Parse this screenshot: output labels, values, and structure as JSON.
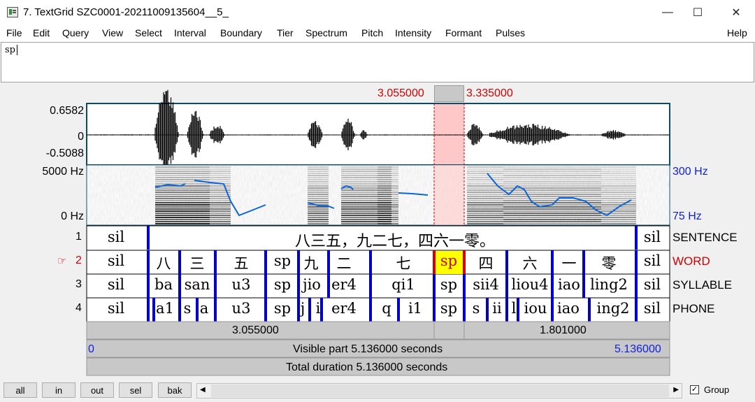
{
  "window": {
    "title": "7. TextGrid SZC0001-20211009135604__5_",
    "minimize": "—",
    "maximize": "☐",
    "close": "✕"
  },
  "menu": [
    "File",
    "Edit",
    "Query",
    "View",
    "Select",
    "Interval",
    "Boundary",
    "Tier",
    "Spectrum",
    "Pitch",
    "Intensity",
    "Formant",
    "Pulses"
  ],
  "help": "Help",
  "text_field": {
    "value": "sp"
  },
  "selection": {
    "start": "3.055000",
    "end": "3.335000"
  },
  "waveform": {
    "ymax": "0.6582",
    "zero": "0",
    "ymin": "-0.5088"
  },
  "spectrogram": {
    "fmax": "5000 Hz",
    "fmin": "0 Hz",
    "pitch_max": "300 Hz",
    "pitch_min": "75 Hz"
  },
  "tiers": [
    {
      "number": "1",
      "name": "SENTENCE",
      "intervals": [
        "sil",
        "八三五，九二七，四六一零。",
        "sil"
      ]
    },
    {
      "number": "2",
      "name": "WORD",
      "selected_mark": "☞",
      "intervals": [
        "sil",
        "八",
        "三",
        "五",
        "sp",
        "九",
        "二",
        "七",
        "sp",
        "四",
        "六",
        "一",
        "零",
        "sil"
      ]
    },
    {
      "number": "3",
      "name": "SYLLABLE",
      "intervals": [
        "sil",
        "ba",
        "san",
        "u3",
        "sp",
        "jio",
        "er4",
        "qi1",
        "sp",
        "sii4",
        "liou4",
        "iao",
        "ling2",
        "sil"
      ]
    },
    {
      "number": "4",
      "name": "PHONE",
      "intervals": [
        "sil",
        "a1",
        "s",
        "a",
        "u3",
        "sp",
        "j",
        "i",
        "er4",
        "q",
        "i1",
        "sp",
        "s",
        "ii",
        "l",
        "iou",
        "iao",
        "ing2",
        "sil"
      ]
    }
  ],
  "time_bar": {
    "left": "3.055000",
    "right": "1.801000"
  },
  "visible": {
    "start": "0",
    "label": "Visible part 5.136000 seconds",
    "end": "5.136000"
  },
  "total": {
    "label": "Total duration 5.136000 seconds"
  },
  "buttons": {
    "all": "all",
    "in": "in",
    "out": "out",
    "sel": "sel",
    "bak": "bak"
  },
  "scroll": {
    "left": "◀",
    "right": "▶"
  },
  "group": {
    "label": "Group",
    "checked": true
  },
  "colors": {
    "selection": "#ffc8c8",
    "boundary": "#0000c8",
    "pitch": "#0a64dc",
    "highlight": "#ffff00",
    "accent_red": "#d20000",
    "accent_blue": "#1020e0"
  }
}
